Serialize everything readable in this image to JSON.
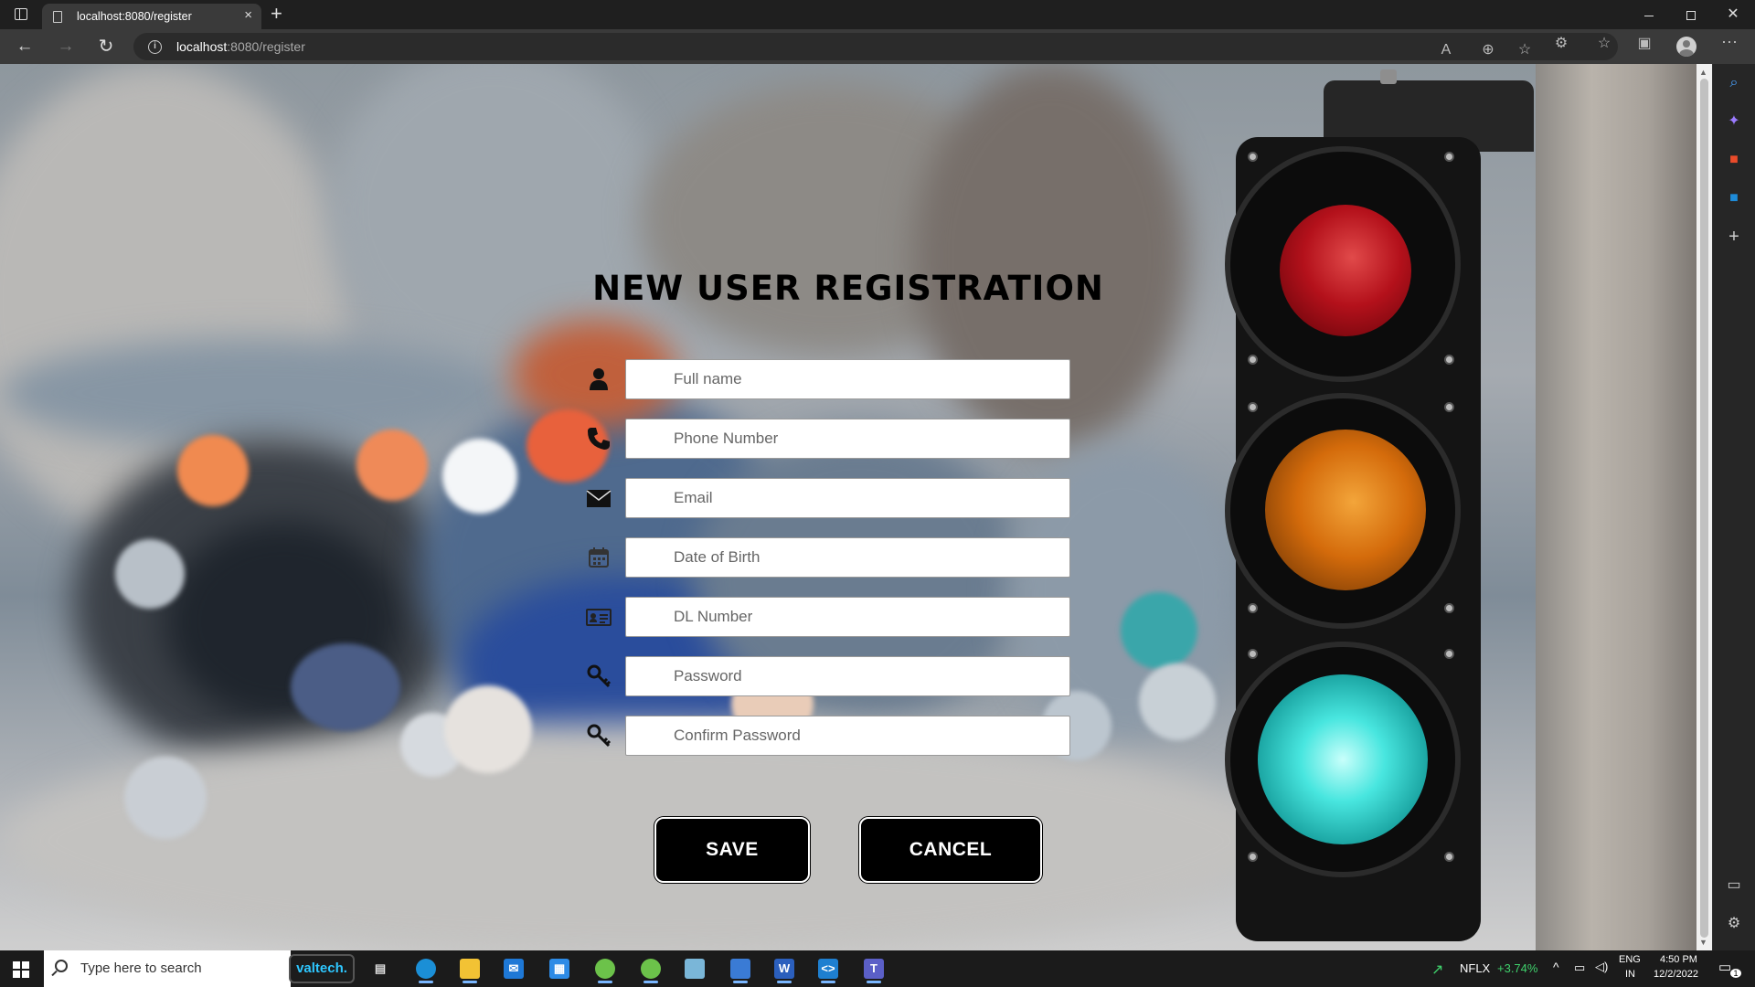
{
  "browser": {
    "tab_title": "localhost:8080/register",
    "tab_close": "×",
    "new_tab": "+",
    "url_host": "localhost",
    "url_rest": ":8080/register"
  },
  "page": {
    "title": "NEW USER REGISTRATION",
    "fields": [
      {
        "icon": "user-icon",
        "placeholder": "Full name"
      },
      {
        "icon": "phone-icon",
        "placeholder": "Phone Number"
      },
      {
        "icon": "envelope-icon",
        "placeholder": "Email"
      },
      {
        "icon": "calendar-icon",
        "placeholder": "Date of Birth"
      },
      {
        "icon": "id-card-icon",
        "placeholder": "DL Number"
      },
      {
        "icon": "key-icon",
        "placeholder": "Password"
      },
      {
        "icon": "key-icon",
        "placeholder": "Confirm Password"
      }
    ],
    "save_label": "SAVE",
    "cancel_label": "CANCEL"
  },
  "taskbar": {
    "search_placeholder": "Type here to search",
    "pinned_label": "valtech.",
    "stock_name": "NFLX",
    "stock_change": "+3.74%",
    "language_line1": "ENG",
    "language_line2": "IN",
    "time": "4:50 PM",
    "date": "12/2/2022",
    "notification_count": "1"
  }
}
